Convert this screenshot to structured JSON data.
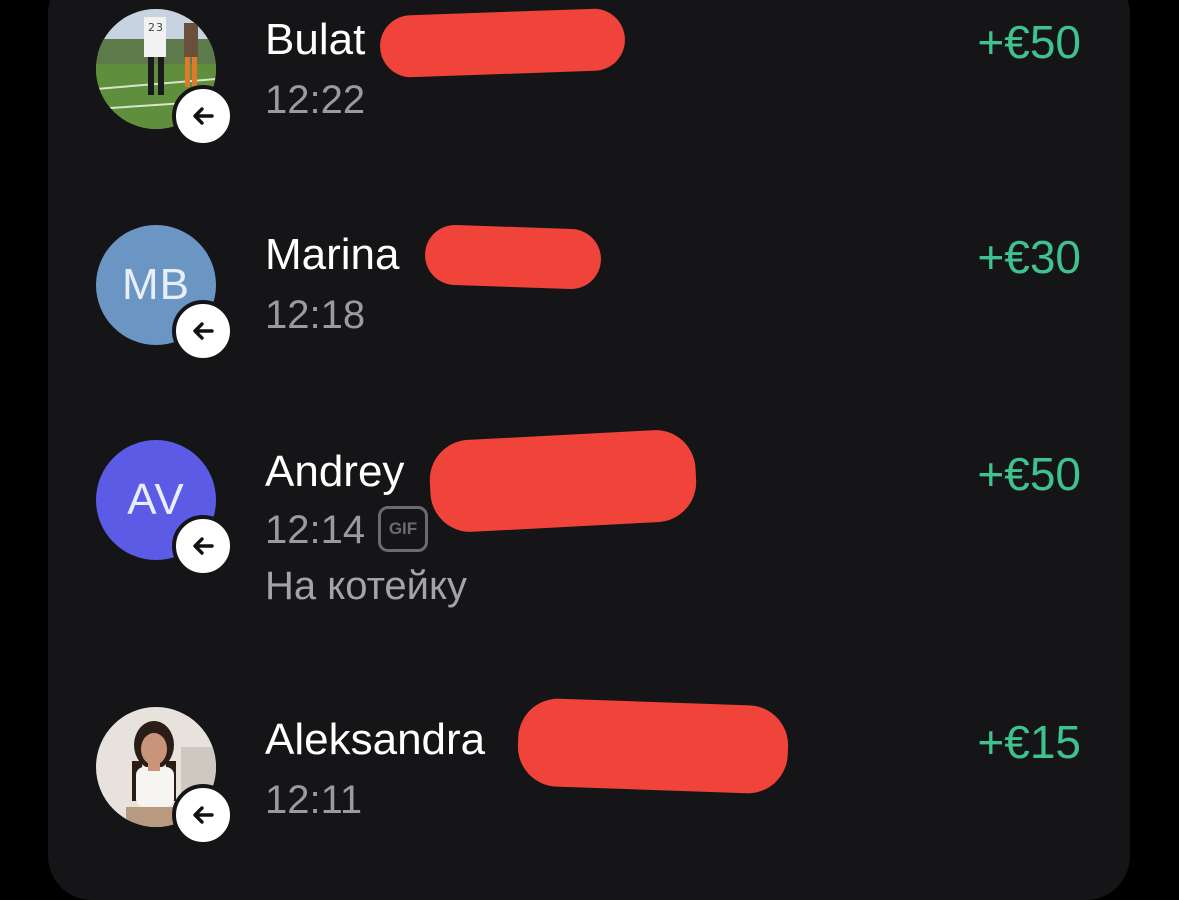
{
  "transactions": [
    {
      "name": "Bulat",
      "time": "12:22",
      "amount": "+€50",
      "avatar": {
        "type": "photo",
        "description_icon": "football-photo"
      },
      "direction_icon": "arrow-left-icon"
    },
    {
      "name": "Marina",
      "time": "12:18",
      "amount": "+€30",
      "avatar": {
        "type": "initials",
        "initials": "MB",
        "color": "#6b95c2"
      },
      "direction_icon": "arrow-left-icon"
    },
    {
      "name": "Andrey",
      "time": "12:14",
      "amount": "+€50",
      "avatar": {
        "type": "initials",
        "initials": "AV",
        "color": "#5b5be6"
      },
      "direction_icon": "arrow-left-icon",
      "attachment_badge": "GIF",
      "comment": "На котейку"
    },
    {
      "name": "Aleksandra",
      "time": "12:11",
      "amount": "+€15",
      "avatar": {
        "type": "photo",
        "description_icon": "portrait-photo"
      },
      "direction_icon": "arrow-left-icon"
    }
  ],
  "colors": {
    "background": "#000000",
    "panel": "#151517",
    "amount_positive": "#3ec28f",
    "redaction": "#f0443a"
  }
}
